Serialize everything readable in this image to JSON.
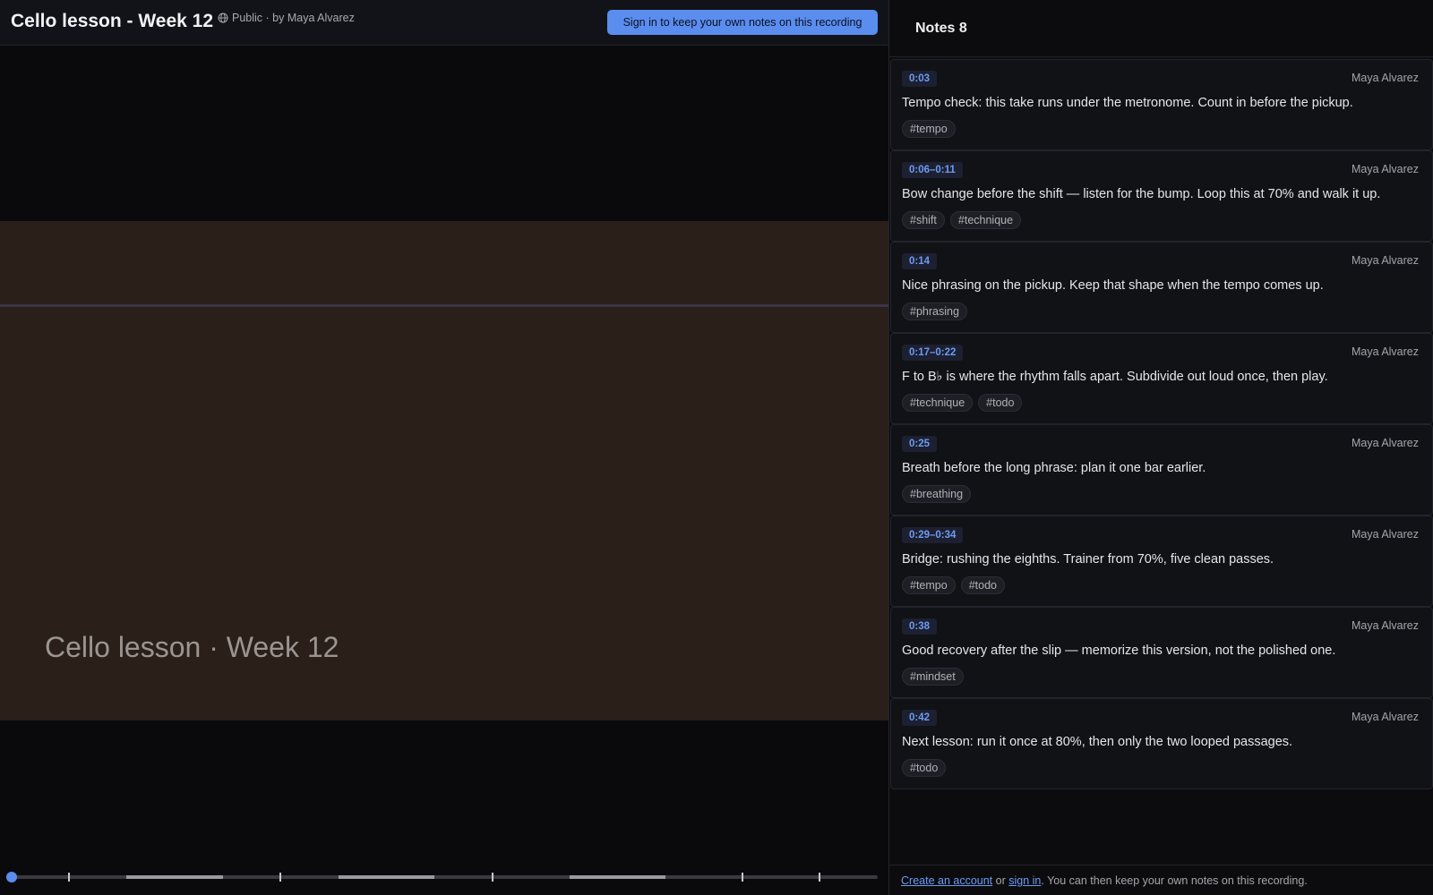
{
  "header": {
    "title": "Cello lesson - Week 12",
    "meta": "Public · by Maya Alvarez",
    "signin_button": "Sign in to keep your own notes on this recording",
    "accent": "#5b8def"
  },
  "video": {
    "caption": "Cello lesson · Week 12"
  },
  "panel": {
    "title": "Notes 8"
  },
  "notes": [
    {
      "time": "0:03",
      "author": "Maya Alvarez",
      "text": "Tempo check: this take runs under the metronome. Count in before the pickup.",
      "tags": [
        "#tempo"
      ]
    },
    {
      "time": "0:06–0:11",
      "author": "Maya Alvarez",
      "text": "Bow change before the shift — listen for the bump. Loop this at 70% and walk it up.",
      "tags": [
        "#shift",
        "#technique"
      ]
    },
    {
      "time": "0:14",
      "author": "Maya Alvarez",
      "text": "Nice phrasing on the pickup. Keep that shape when the tempo comes up.",
      "tags": [
        "#phrasing"
      ]
    },
    {
      "time": "0:17–0:22",
      "author": "Maya Alvarez",
      "text": "F to B♭ is where the rhythm falls apart. Subdivide out loud once, then play.",
      "tags": [
        "#technique",
        "#todo"
      ]
    },
    {
      "time": "0:25",
      "author": "Maya Alvarez",
      "text": "Breath before the long phrase: plan it one bar earlier.",
      "tags": [
        "#breathing"
      ]
    },
    {
      "time": "0:29–0:34",
      "author": "Maya Alvarez",
      "text": "Bridge: rushing the eighths. Trainer from 70%, five clean passes.",
      "tags": [
        "#tempo",
        "#todo"
      ]
    },
    {
      "time": "0:38",
      "author": "Maya Alvarez",
      "text": "Good recovery after the slip — memorize this version, not the polished one.",
      "tags": [
        "#mindset"
      ]
    },
    {
      "time": "0:42",
      "author": "Maya Alvarez",
      "text": "Next lesson: run it once at 80%, then only the two looped passages.",
      "tags": [
        "#todo"
      ]
    }
  ],
  "footer": {
    "create_account": "Create an account",
    "or": " or ",
    "sign_in": "sign in",
    "rest": ". You can then keep your own notes on this recording."
  }
}
